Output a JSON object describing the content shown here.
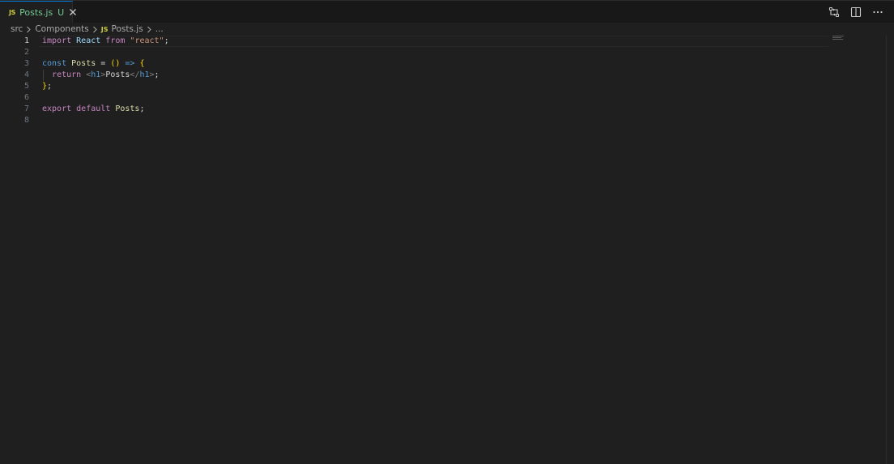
{
  "tab": {
    "badge": "JS",
    "filename": "Posts.js",
    "status": "U"
  },
  "breadcrumb": {
    "items": [
      "src",
      "Components"
    ],
    "file_badge": "JS",
    "file": "Posts.js",
    "more": "..."
  },
  "editor": {
    "line_numbers": [
      "1",
      "2",
      "3",
      "4",
      "5",
      "6",
      "7",
      "8"
    ],
    "lines": [
      [
        {
          "t": "import",
          "c": "kw-ctrl"
        },
        {
          "t": " "
        },
        {
          "t": "React",
          "c": "var"
        },
        {
          "t": " "
        },
        {
          "t": "from",
          "c": "kw-ctrl"
        },
        {
          "t": " "
        },
        {
          "t": "\"react\"",
          "c": "str"
        },
        {
          "t": ";",
          "c": "punc"
        }
      ],
      [],
      [
        {
          "t": "const",
          "c": "kw"
        },
        {
          "t": " "
        },
        {
          "t": "Posts",
          "c": "fn"
        },
        {
          "t": " = ",
          "c": "punc"
        },
        {
          "t": "()",
          "c": "brace"
        },
        {
          "t": " "
        },
        {
          "t": "=>",
          "c": "kw"
        },
        {
          "t": " "
        },
        {
          "t": "{",
          "c": "brace"
        }
      ],
      [
        {
          "t": "  "
        },
        {
          "t": "return",
          "c": "kw-ctrl"
        },
        {
          "t": " "
        },
        {
          "t": "<",
          "c": "tagb"
        },
        {
          "t": "h1",
          "c": "tag"
        },
        {
          "t": ">",
          "c": "tagb"
        },
        {
          "t": "Posts",
          "c": "txt"
        },
        {
          "t": "</",
          "c": "tagb"
        },
        {
          "t": "h1",
          "c": "tag"
        },
        {
          "t": ">",
          "c": "tagb"
        },
        {
          "t": ";",
          "c": "punc"
        }
      ],
      [
        {
          "t": "}",
          "c": "brace"
        },
        {
          "t": ";",
          "c": "punc"
        }
      ],
      [],
      [
        {
          "t": "export",
          "c": "kw-ctrl"
        },
        {
          "t": " "
        },
        {
          "t": "default",
          "c": "kw-ctrl"
        },
        {
          "t": " "
        },
        {
          "t": "Posts",
          "c": "fn"
        },
        {
          "t": ";",
          "c": "punc"
        }
      ],
      []
    ]
  },
  "actions": {
    "icons": [
      "source-control-diff-icon",
      "split-editor-icon",
      "more-actions-icon"
    ]
  },
  "colors": {
    "accent": "#0078d4",
    "untracked": "#73c991",
    "js_badge": "#cbcb41"
  }
}
